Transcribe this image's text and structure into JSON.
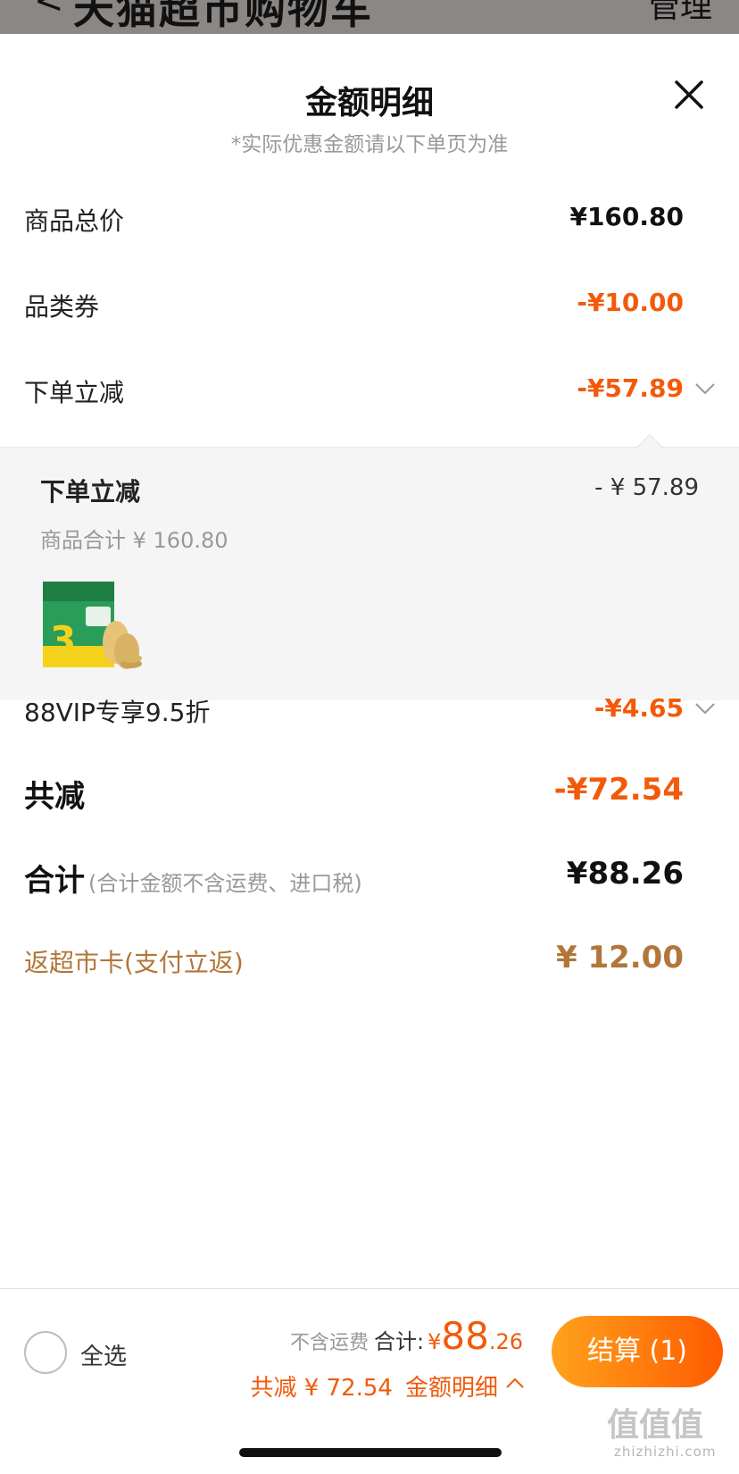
{
  "topbar": {
    "back_glyph": "<",
    "title": "天猫超市购物车",
    "right_glyph": "管理"
  },
  "sheet": {
    "title": "金额明细",
    "subtitle": "*实际优惠金额请以下单页为准",
    "rows": [
      {
        "label": "商品总价",
        "value": "¥160.80"
      },
      {
        "label": "品类券",
        "value": "-¥10.00"
      },
      {
        "label": "下单立减",
        "value": "-¥57.89"
      }
    ],
    "detail_panel": {
      "title": "下单立减",
      "amount": "- ¥ 57.89",
      "subtotal": "商品合计 ¥ 160.80",
      "product_image": "product-thumbnail"
    },
    "vip_row": {
      "label": "88VIP专享9.5折",
      "value": "-¥4.65"
    },
    "total_reduction": {
      "label": "共减",
      "value": "-¥72.54"
    },
    "total": {
      "label": "合计",
      "note": "(合计金额不含运费、进口税)",
      "value": "¥88.26"
    },
    "cashback": {
      "label": "返超市卡(支付立返)",
      "value": "¥ 12.00"
    }
  },
  "bottom_bar": {
    "select_all": "全选",
    "exclude_shipping": "不含运费",
    "total_label": "合计:",
    "currency": "¥",
    "total_int": "88",
    "total_dec": ".26",
    "reduction_text": "共减 ¥ 72.54",
    "detail_link": "金额明细",
    "checkout": "结算 (1)"
  },
  "watermark": {
    "glyphs": "值值值",
    "site": "zhizhizhi.com"
  },
  "colors": {
    "accent": "#f25a0a",
    "gold": "#b2763a",
    "checkout_start": "#ffa21c",
    "checkout_end": "#ff5b00"
  }
}
